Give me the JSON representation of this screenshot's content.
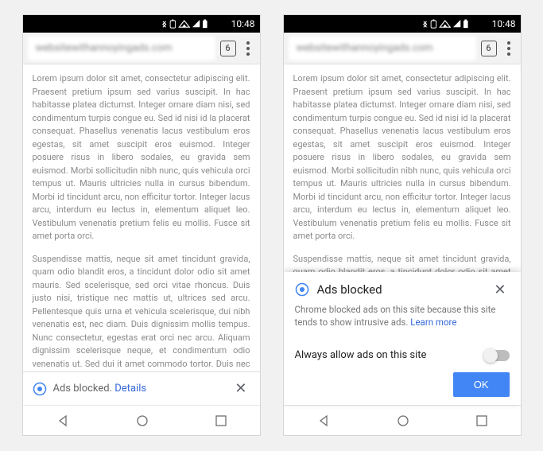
{
  "status": {
    "time": "10:48"
  },
  "toolbar": {
    "url": "websitewithannoyingads.com",
    "tab_count": "6"
  },
  "body_text": {
    "para1": "Lorem ipsum dolor sit amet, consectetur adipiscing elit. Praesent pretium ipsum sed varius suscipit. In hac habitasse platea dictumst. Integer ornare diam nisi, sed condimentum turpis congue eu. Sed id nisi id la placerat consequat. Phasellus venenatis lacus vestibulum eros egestas, sit amet suscipit eros euismod. Integer posuere risus in libero sodales, eu gravida sem euismod. Morbi sollicitudin nibh nunc, quis vehicula orci tempus ut. Mauris ultricies nulla in cursus bibendum. Morbi id tincidunt arcu, non efficitur tortor. Integer lacus arcu, interdum eu lectus in, elementum aliquet leo. Vestibulum venenatis pretium felis eu mollis. Fusce sit amet porta orci.",
    "para2": "Suspendisse mattis, neque sit amet tincidunt gravida, quam odio blandit eros, a tincidunt dolor odio sit amet mauris. Sed scelerisque, sed orci vitae rhoncus. Duis justo nisi, tristique nec mattis ut, ultrices sed arcu. Pellentesque quis urna et vehicula scelerisque, dui nibh venenatis est, nec diam. Duis dignissim mollis tempus. Nunc consectetur, egestas erat orci nec arcu. Aliquam dignissim scelerisque neque, et condimentum odio venenatis ut. Sed dui it amet commodo tortor. Duis nec augue id massa ultrices sollicitudin. Maecenas convallis massa eros, quis dignissim purus venenatis vel. Cras ex leo, varius sit amet risus ut, varius venenatis erat. Vestibulum egestas orci venenatis"
  },
  "infobar": {
    "message": "Ads blocked.",
    "link": "Details"
  },
  "sheet": {
    "title": "Ads blocked",
    "description": "Chrome blocked ads on this site because this site tends to show intrusive ads.",
    "learn_more": "Learn more",
    "toggle_label": "Always allow ads on this site",
    "ok_label": "OK"
  }
}
